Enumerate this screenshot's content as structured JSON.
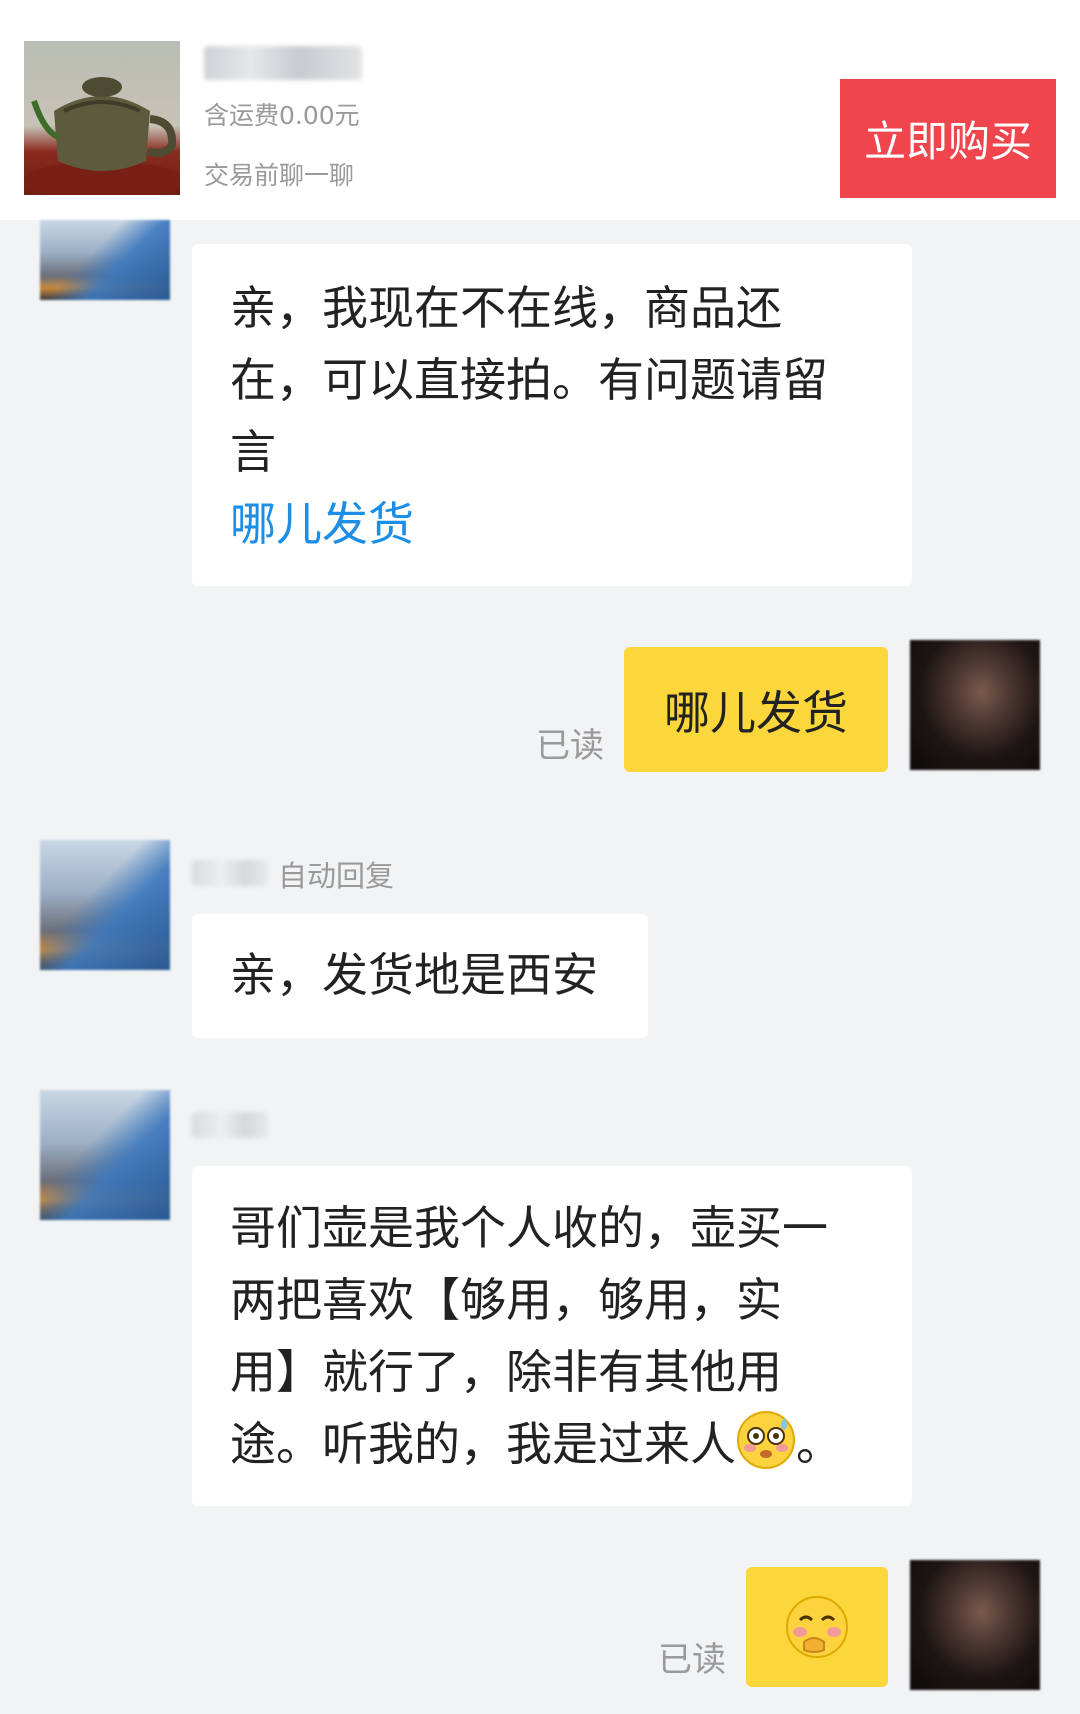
{
  "header": {
    "price": "",
    "shipping": "含运费0.00元",
    "chat_before": "交易前聊一聊",
    "buy_label": "立即购买"
  },
  "messages": {
    "m1": {
      "line1": "亲，我现在不在线，商品还",
      "line2": "在，可以直接拍。有问题请留",
      "line3": "言",
      "link": "哪儿发货"
    },
    "m2": {
      "text": "哪儿发货",
      "status": "已读"
    },
    "m3": {
      "sender_tag": "自动回复",
      "text": "亲，发货地是西安"
    },
    "m4": {
      "line1": "哥们壶是我个人收的，壶买一",
      "line2": "两把喜欢【够用，够用，实",
      "line3": "用】就行了，除非有其他用",
      "line4": "途。听我的，我是过来人",
      "tail": "。"
    },
    "m5": {
      "status": "已读",
      "emoji": "shy-face-emoji"
    }
  },
  "colors": {
    "buy_button": "#f0454d",
    "own_bubble": "#fcd73c",
    "link": "#1d8ee6"
  }
}
